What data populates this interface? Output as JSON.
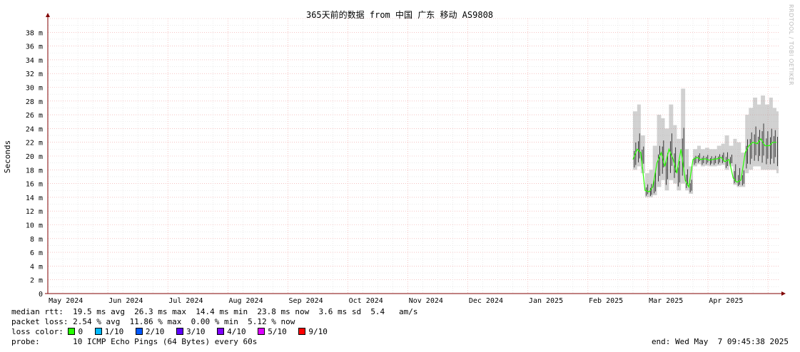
{
  "chart_data": {
    "type": "line",
    "title": "365天前的数据 from 中国 广东 移动 AS9808",
    "ylabel": "Seconds",
    "xlabel": "",
    "ylim": [
      0,
      40
    ],
    "y_unit": "ms",
    "y_tick_labels": [
      "0",
      "2 m",
      "4 m",
      "6 m",
      "8 m",
      "10 m",
      "12 m",
      "14 m",
      "16 m",
      "18 m",
      "20 m",
      "22 m",
      "24 m",
      "26 m",
      "28 m",
      "30 m",
      "32 m",
      "34 m",
      "36 m",
      "38 m"
    ],
    "x_tick_labels": [
      "May 2024",
      "Jun 2024",
      "Jul 2024",
      "Aug 2024",
      "Sep 2024",
      "Oct 2024",
      "Nov 2024",
      "Dec 2024",
      "Jan 2025",
      "Feb 2025",
      "Mar 2025",
      "Apr 2025"
    ],
    "x_range_months": [
      0,
      12.2
    ],
    "grid": true,
    "series": [
      {
        "name": "median rtt",
        "x_months": [
          9.75,
          9.82,
          9.88,
          9.95,
          10.02,
          10.08,
          10.15,
          10.22,
          10.28,
          10.35,
          10.42,
          10.48,
          10.55,
          10.62,
          10.68,
          10.75,
          10.82,
          10.88,
          10.95,
          11.02,
          11.08,
          11.15,
          11.22,
          11.28,
          11.35,
          11.42,
          11.48,
          11.55,
          11.62,
          11.68,
          11.75,
          11.82,
          11.88,
          11.95,
          12.02,
          12.08,
          12.14
        ],
        "median": [
          19.5,
          21.0,
          20.5,
          15.0,
          14.8,
          15.5,
          19.0,
          20.5,
          18.5,
          21.0,
          19.5,
          17.5,
          21.0,
          16.5,
          15.5,
          19.5,
          19.8,
          19.5,
          19.6,
          19.4,
          19.5,
          19.6,
          19.8,
          19.2,
          19.5,
          16.8,
          16.2,
          16.5,
          20.5,
          21.5,
          22.0,
          21.8,
          22.5,
          21.5,
          21.5,
          22.0,
          22.0
        ],
        "min": [
          18.0,
          18.5,
          17.5,
          14.0,
          14.0,
          14.3,
          15.5,
          16.5,
          15.0,
          16.5,
          16.0,
          15.0,
          16.0,
          15.0,
          14.5,
          18.5,
          18.8,
          18.5,
          18.6,
          18.5,
          18.5,
          18.6,
          18.7,
          18.0,
          18.5,
          15.8,
          15.5,
          15.5,
          17.5,
          18.0,
          18.5,
          18.5,
          18.0,
          18.0,
          18.0,
          18.0,
          17.5
        ],
        "max": [
          26.5,
          27.5,
          23.0,
          17.5,
          18.0,
          21.5,
          26.0,
          25.5,
          24.0,
          27.5,
          24.5,
          22.5,
          29.8,
          21.0,
          18.5,
          21.0,
          21.5,
          21.0,
          21.2,
          21.0,
          21.0,
          21.5,
          21.8,
          23.0,
          21.5,
          22.5,
          22.0,
          20.5,
          26.0,
          27.0,
          28.5,
          27.5,
          28.8,
          27.5,
          28.5,
          27.0,
          26.5
        ]
      }
    ]
  },
  "legend": {
    "median_rtt_line": "median rtt:  19.5 ms avg  26.3 ms max  14.4 ms min  23.8 ms now  3.6 ms sd  5.4   am/s",
    "packet_loss_line": "packet loss: 2.54 % avg  11.86 % max  0.00 % min  5.12 % now",
    "loss_color_label": "loss color:",
    "loss_colors": [
      {
        "label": "0",
        "color": "#26ff00"
      },
      {
        "label": "1/10",
        "color": "#00b8ff"
      },
      {
        "label": "2/10",
        "color": "#0059ff"
      },
      {
        "label": "3/10",
        "color": "#5e00ff"
      },
      {
        "label": "4/10",
        "color": "#7e00ff"
      },
      {
        "label": "5/10",
        "color": "#dd00ff"
      },
      {
        "label": "9/10",
        "color": "#ff0000"
      }
    ],
    "probe_line": "probe:       10 ICMP Echo Pings (64 Bytes) every 60s",
    "end_line": "end: Wed May  7 09:45:38 2025"
  },
  "watermark": "RRDTOOL / TOBI OETIKER",
  "colors": {
    "grid_minor": "#dddddd",
    "grid_major": "#f0a0a0",
    "axis": "#800000",
    "smoke": "#999999",
    "median": "#26ff00"
  }
}
